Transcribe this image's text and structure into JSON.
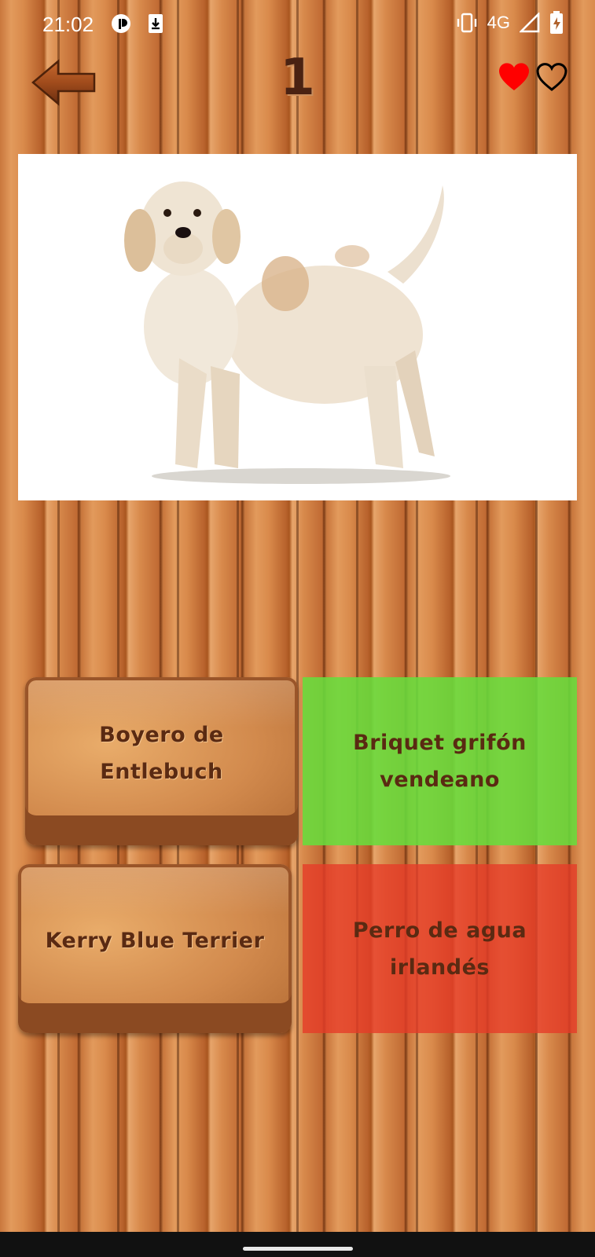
{
  "status_bar": {
    "time": "21:02",
    "network": "4G",
    "icons": [
      "cast-app-icon",
      "download-icon",
      "vibrate-icon",
      "signal-icon",
      "battery-charging-icon"
    ]
  },
  "top_bar": {
    "back_icon": "arrow-left-icon",
    "level": "1",
    "lives": {
      "filled": 1,
      "total": 2,
      "filled_color": "#ff0000"
    }
  },
  "question": {
    "image": "dog-photo"
  },
  "answers": [
    {
      "label": "Boyero de Entlebuch",
      "state": "neutral"
    },
    {
      "label": "Briquet grifón vendeano",
      "state": "correct",
      "color": "#68dd3c"
    },
    {
      "label": "Kerry Blue Terrier",
      "state": "neutral"
    },
    {
      "label": "Perro de agua irlandés",
      "state": "wrong",
      "color": "#e63c28"
    }
  ]
}
